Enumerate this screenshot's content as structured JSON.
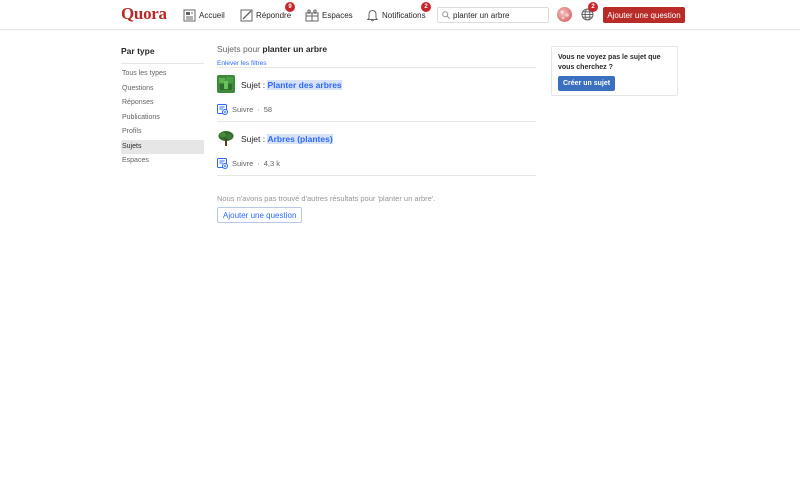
{
  "header": {
    "logo": "Quora",
    "nav": [
      {
        "label": "Accueil",
        "icon": "home-icon"
      },
      {
        "label": "Répondre",
        "icon": "pencil-icon",
        "badge": "9"
      },
      {
        "label": "Espaces",
        "icon": "spaces-icon"
      },
      {
        "label": "Notifications",
        "icon": "bell-icon",
        "badge": "2"
      }
    ],
    "search_value": "planter un arbre",
    "globe_badge": "2",
    "ask_button": "Ajouter une question"
  },
  "sidebar": {
    "title": "Par type",
    "items": [
      {
        "label": "Tous les types"
      },
      {
        "label": "Questions"
      },
      {
        "label": "Réponses"
      },
      {
        "label": "Publications"
      },
      {
        "label": "Profils"
      },
      {
        "label": "Sujets",
        "active": true
      },
      {
        "label": "Espaces"
      }
    ]
  },
  "main": {
    "heading_prefix": "Sujets pour ",
    "heading_query": "planter un arbre",
    "remove_filters": "Enlever les filtres",
    "topics": [
      {
        "prefix": "Sujet : ",
        "name": "Planter des arbres",
        "follow_label": "Suivre",
        "separator": "·",
        "followers": "58"
      },
      {
        "prefix": "Sujet : ",
        "name": "Arbres (plantes)",
        "follow_label": "Suivre",
        "separator": "·",
        "followers": "4,3 k"
      }
    ],
    "no_more_results": "Nous n'avons pas trouvé d'autres résultats pour 'planter un arbre'.",
    "ask_button": "Ajouter une question"
  },
  "card": {
    "text": "Vous ne voyez pas le sujet que vous cherchez ?",
    "button": "Créer un sujet"
  },
  "colors": {
    "brand": "#b92b27",
    "link": "#2e69ff",
    "badge": "#c6262c"
  }
}
